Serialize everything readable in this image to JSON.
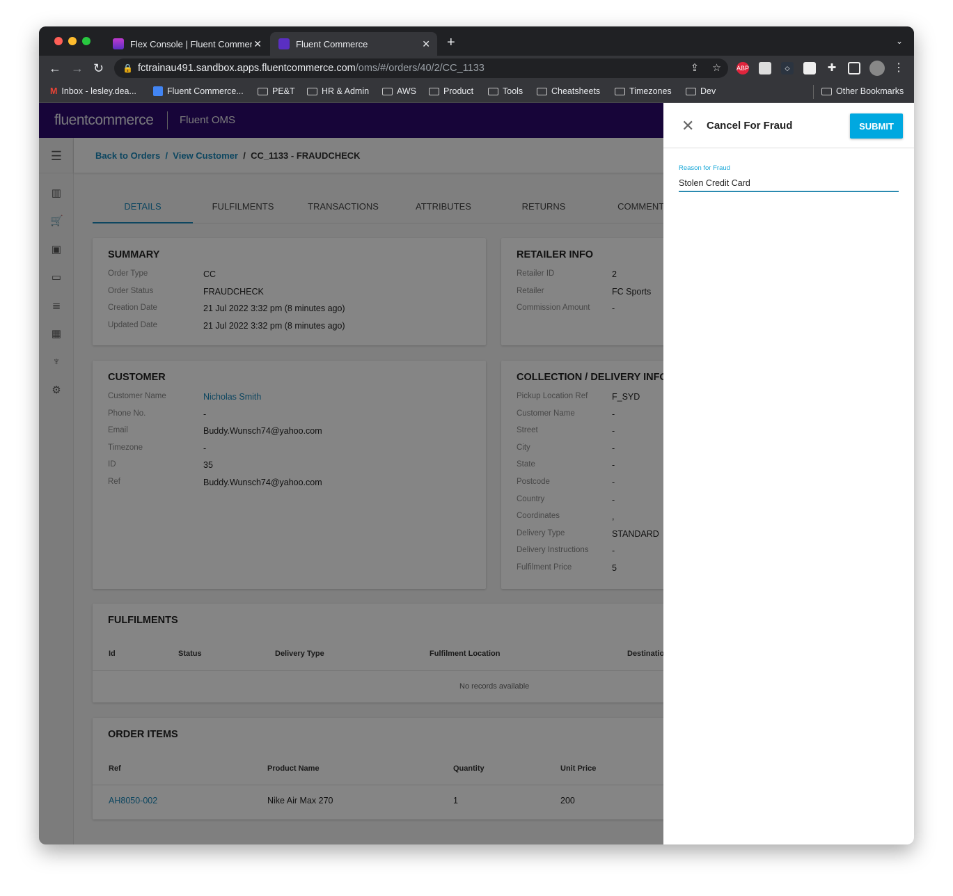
{
  "browser": {
    "tabs": [
      {
        "title": "Flex Console | Fluent Commerc"
      },
      {
        "title": "Fluent Commerce"
      }
    ],
    "url_host": "fctrainau491.sandbox.apps.fluentcommerce.com",
    "url_path": "/oms/#/orders/40/2/CC_1133",
    "extensions": {
      "abp": "ABP"
    },
    "bookmarks": [
      "Inbox - lesley.dea...",
      "Fluent Commerce...",
      "PE&T",
      "HR & Admin",
      "AWS",
      "Product",
      "Tools",
      "Cheatsheets",
      "Timezones",
      "Dev"
    ],
    "other_bookmarks": "Other Bookmarks"
  },
  "app": {
    "logo": "fluentcommerce",
    "product": "Fluent OMS",
    "breadcrumb": {
      "back": "Back to Orders",
      "customer": "View Customer",
      "current": "CC_1133 - FRAUDCHECK"
    },
    "tabs": [
      "DETAILS",
      "FULFILMENTS",
      "TRANSACTIONS",
      "ATTRIBUTES",
      "RETURNS",
      "COMMENTS"
    ],
    "summary": {
      "title": "SUMMARY",
      "rows": [
        {
          "k": "Order Type",
          "v": "CC"
        },
        {
          "k": "Order Status",
          "v": "FRAUDCHECK"
        },
        {
          "k": "Creation Date",
          "v": "21 Jul 2022 3:32 pm (8 minutes ago)"
        },
        {
          "k": "Updated Date",
          "v": "21 Jul 2022 3:32 pm (8 minutes ago)"
        }
      ]
    },
    "retailer": {
      "title": "RETAILER INFO",
      "rows": [
        {
          "k": "Retailer ID",
          "v": "2"
        },
        {
          "k": "Retailer",
          "v": "FC Sports"
        },
        {
          "k": "Commission Amount",
          "v": "-"
        }
      ]
    },
    "customer": {
      "title": "CUSTOMER",
      "rows": [
        {
          "k": "Customer Name",
          "v": "Nicholas Smith"
        },
        {
          "k": "Phone No.",
          "v": "-"
        },
        {
          "k": "Email",
          "v": "Buddy.Wunsch74@yahoo.com"
        },
        {
          "k": "Timezone",
          "v": "-"
        },
        {
          "k": "ID",
          "v": "35"
        },
        {
          "k": "Ref",
          "v": "Buddy.Wunsch74@yahoo.com"
        }
      ]
    },
    "collection": {
      "title": "COLLECTION / DELIVERY INFO",
      "rows": [
        {
          "k": "Pickup Location Ref",
          "v": "F_SYD"
        },
        {
          "k": "Customer Name",
          "v": "-"
        },
        {
          "k": "Street",
          "v": "-"
        },
        {
          "k": "City",
          "v": "-"
        },
        {
          "k": "State",
          "v": "-"
        },
        {
          "k": "Postcode",
          "v": "-"
        },
        {
          "k": "Country",
          "v": "-"
        },
        {
          "k": "Coordinates",
          "v": ","
        },
        {
          "k": "Delivery Type",
          "v": "STANDARD"
        },
        {
          "k": "Delivery Instructions",
          "v": "-"
        },
        {
          "k": "Fulfilment Price",
          "v": "5"
        }
      ]
    },
    "fulfilments": {
      "title": "FULFILMENTS",
      "columns": [
        "Id",
        "Status",
        "Delivery Type",
        "Fulfilment Location",
        "Destination"
      ],
      "empty": "No records available"
    },
    "order_items": {
      "title": "ORDER ITEMS",
      "columns": [
        "Ref",
        "Product Name",
        "Quantity",
        "Unit Price"
      ],
      "rows": [
        {
          "ref": "AH8050-002",
          "name": "Nike Air Max 270",
          "qty": "1",
          "price": "200"
        }
      ]
    }
  },
  "panel": {
    "title": "Cancel For Fraud",
    "submit": "SUBMIT",
    "field_label": "Reason for Fraud",
    "field_value": "Stolen Credit Card"
  },
  "colors": {
    "brand": "#2c0b6e",
    "accent": "#00a8e0",
    "link": "#1a86b8"
  }
}
